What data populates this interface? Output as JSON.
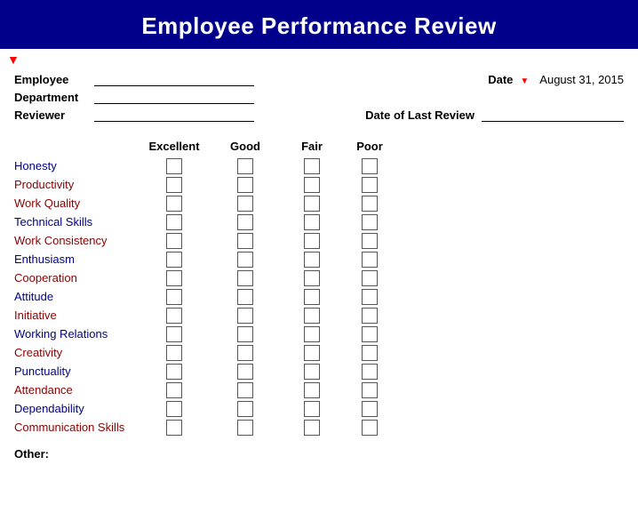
{
  "header": {
    "title": "Employee Performance Review"
  },
  "form": {
    "employee_label": "Employee",
    "department_label": "Department",
    "reviewer_label": "Reviewer",
    "date_label": "Date",
    "date_value": "August 31, 2015",
    "last_review_label": "Date of Last Review"
  },
  "rating_headers": {
    "excellent": "Excellent",
    "good": "Good",
    "fair": "Fair",
    "poor": "Poor"
  },
  "criteria": [
    {
      "label": "Honesty",
      "color": "blue"
    },
    {
      "label": "Productivity",
      "color": "dark-red"
    },
    {
      "label": "Work Quality",
      "color": "dark-red"
    },
    {
      "label": "Technical Skills",
      "color": "blue"
    },
    {
      "label": "Work Consistency",
      "color": "dark-red"
    },
    {
      "label": "Enthusiasm",
      "color": "blue"
    },
    {
      "label": "Cooperation",
      "color": "dark-red"
    },
    {
      "label": "Attitude",
      "color": "blue"
    },
    {
      "label": "Initiative",
      "color": "dark-red"
    },
    {
      "label": "Working Relations",
      "color": "blue"
    },
    {
      "label": "Creativity",
      "color": "dark-red"
    },
    {
      "label": "Punctuality",
      "color": "blue"
    },
    {
      "label": "Attendance",
      "color": "dark-red"
    },
    {
      "label": "Dependability",
      "color": "blue"
    },
    {
      "label": "Communication Skills",
      "color": "dark-red"
    }
  ],
  "other_label": "Other:"
}
